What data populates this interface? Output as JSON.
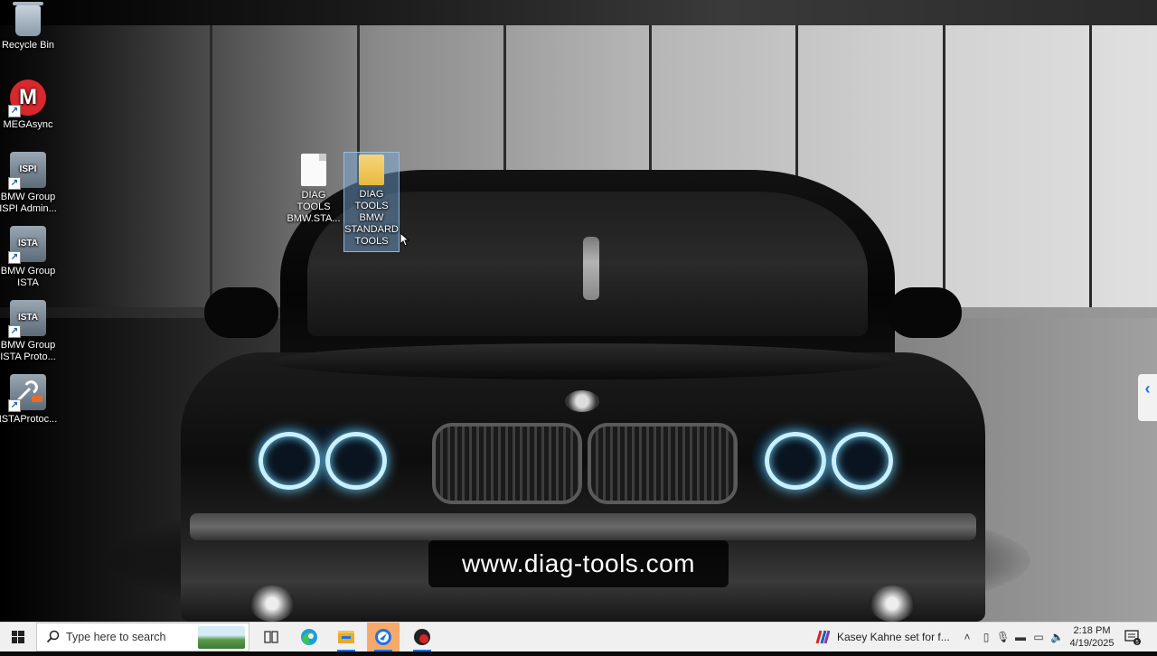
{
  "desktop": {
    "icons": [
      {
        "label1": "Recycle Bin",
        "label2": ""
      },
      {
        "label1": "MEGAsync",
        "label2": ""
      },
      {
        "label1": "BMW Group",
        "label2": "ISPI Admin..."
      },
      {
        "label1": "BMW Group",
        "label2": "ISTA"
      },
      {
        "label1": "BMW Group",
        "label2": "ISTA Proto..."
      },
      {
        "label1": "ISTAProtoc...",
        "label2": ""
      }
    ],
    "icon_text": {
      "mega": "M",
      "ispi": "ISPI",
      "ista": "ISTA",
      "ista_proto": "ISTA"
    },
    "files": [
      {
        "label1": "DIAG TOOLS",
        "label2": "BMW.STA..."
      },
      {
        "label1": "DIAG TOOLS",
        "label2": "BMW",
        "label3": "STANDARD",
        "label4": "TOOLS"
      }
    ]
  },
  "watermark": "www.diag-tools.com",
  "side_tab": "‹",
  "taskbar": {
    "search_placeholder": "Type here to search",
    "news_text": "Kasey Kahne set for f...",
    "time": "2:18 PM",
    "date": "4/19/2025",
    "notification_count": "5"
  },
  "colors": {
    "taskbar_bg": "#f0f0f0",
    "active_app": "#f7a96b",
    "accent": "#1a73e8"
  }
}
